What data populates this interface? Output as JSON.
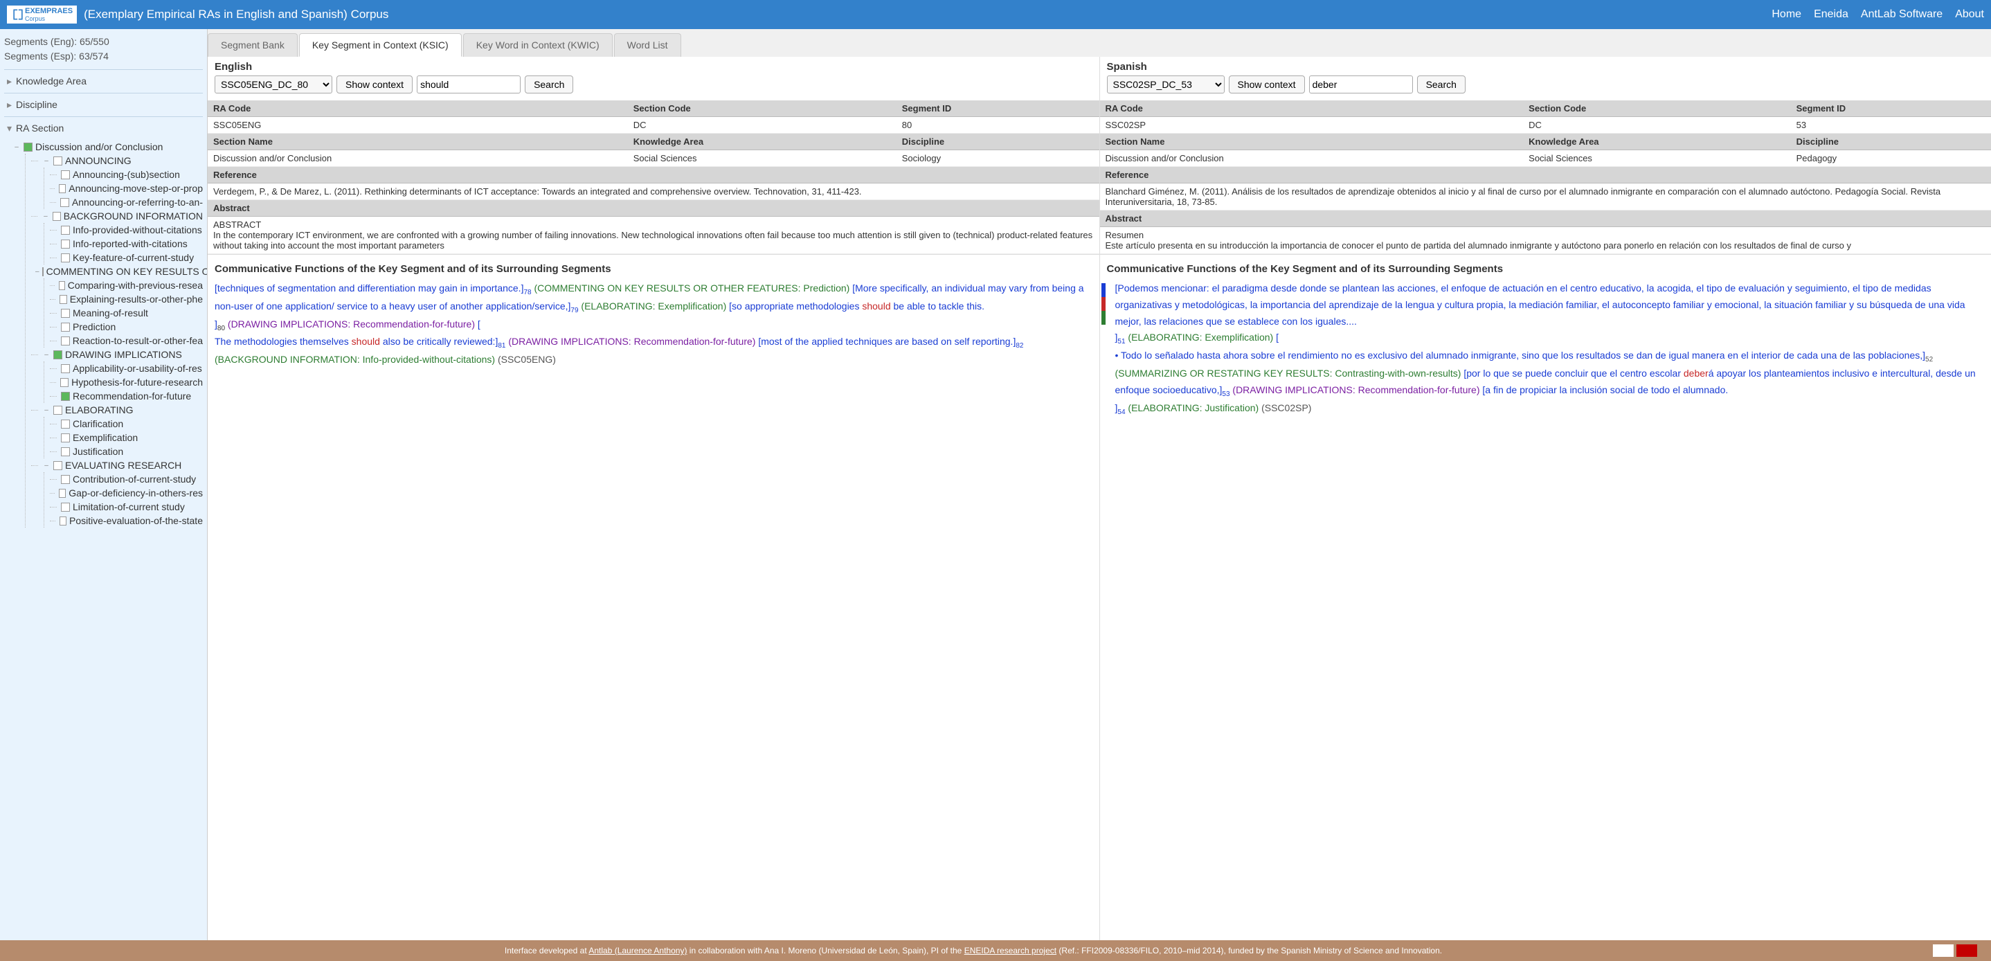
{
  "header": {
    "logo_main": "EXEMPRAES",
    "logo_sub": "Corpus",
    "title": "(Exemplary Empirical RAs in English and Spanish) Corpus",
    "nav": [
      "Home",
      "Eneida",
      "AntLab Software",
      "About"
    ]
  },
  "sidebar": {
    "seg_eng": "Segments (Eng): 65/550",
    "seg_esp": "Segments (Esp): 63/574",
    "sections": [
      "Knowledge Area",
      "Discipline",
      "RA Section"
    ],
    "tree_root": "Discussion and/or Conclusion",
    "groups": [
      {
        "label": "ANNOUNCING",
        "chk": "",
        "children": [
          "Announcing-(sub)section",
          "Announcing-move-step-or-prop",
          "Announcing-or-referring-to-an-"
        ]
      },
      {
        "label": "BACKGROUND INFORMATION",
        "chk": "",
        "children": [
          "Info-provided-without-citations",
          "Info-reported-with-citations",
          "Key-feature-of-current-study"
        ]
      },
      {
        "label": "COMMENTING ON KEY RESULTS O",
        "chk": "",
        "children": [
          "Comparing-with-previous-resea",
          "Explaining-results-or-other-phe",
          "Meaning-of-result",
          "Prediction",
          "Reaction-to-result-or-other-fea"
        ]
      },
      {
        "label": "DRAWING IMPLICATIONS",
        "chk": "partial",
        "children": [
          "Applicability-or-usability-of-res",
          "Hypothesis-for-future-research"
        ],
        "checked_child": "Recommendation-for-future"
      },
      {
        "label": "ELABORATING",
        "chk": "",
        "children": [
          "Clarification",
          "Exemplification",
          "Justification"
        ]
      },
      {
        "label": "EVALUATING RESEARCH",
        "chk": "",
        "children": [
          "Contribution-of-current-study",
          "Gap-or-deficiency-in-others-res",
          "Limitation-of-current study",
          "Positive-evaluation-of-the-state"
        ]
      }
    ]
  },
  "tabs": [
    "Segment Bank",
    "Key Segment in Context (KSIC)",
    "Key Word in Context (KWIC)",
    "Word List"
  ],
  "active_tab": 1,
  "panels": [
    {
      "lang": "English",
      "code_select": "SSC05ENG_DC_80",
      "show_context": "Show context",
      "search_val": "should",
      "search_btn": "Search",
      "meta": {
        "headers1": [
          "RA Code",
          "Section Code",
          "Segment ID"
        ],
        "row1": [
          "SSC05ENG",
          "DC",
          "80"
        ],
        "headers2": [
          "Section Name",
          "Knowledge Area",
          "Discipline"
        ],
        "row2": [
          "Discussion and/or Conclusion",
          "Social Sciences",
          "Sociology"
        ],
        "ref_h": "Reference",
        "ref": "Verdegem, P., & De Marez, L. (2011). Rethinking determinants of ICT acceptance: Towards an integrated and comprehensive overview. Technovation, 31, 411-423.",
        "abs_h": "Abstract",
        "abs": "ABSTRACT\nIn the contemporary ICT environment, we are confronted with a growing number of failing innovations. New technological innovations often fail because too much attention is still given to (technical) product-related features without taking into account the most important parameters"
      },
      "comm_h": "Communicative Functions of the Key Segment and of its Surrounding Segments",
      "comm": {
        "seg1": "[techniques of segmentation and differentiation may gain in importance.]",
        "sub1": "78",
        "lbl1": " (COMMENTING ON KEY RESULTS OR OTHER FEATURES: Prediction) ",
        "seg2": "[More specifically, an individual may vary from being a non-user of one application/ service to a heavy user of another application/service,]",
        "sub2": "79",
        "lbl2": " (ELABORATING: Exemplification) ",
        "seg3a": "[so appropriate methodologies ",
        "seg3_hl": "should",
        "seg3b": " be able to tackle this.</p>]",
        "sub3": "80",
        "lbl3": " (DRAWING IMPLICATIONS: Recommendation-for-future) ",
        "seg4a": "[<p>The methodologies themselves ",
        "seg4_hl": "should",
        "seg4b": " also be critically reviewed:]",
        "sub4": "81",
        "lbl4": " (DRAWING IMPLICATIONS: Recommendation-for-future) ",
        "seg5": "[most of the applied techniques are based on self reporting.]",
        "sub5": "82",
        "lbl5": " (BACKGROUND INFORMATION: Info-provided-without-citations)",
        "code": " (SSC05ENG)"
      }
    },
    {
      "lang": "Spanish",
      "code_select": "SSC02SP_DC_53",
      "show_context": "Show context",
      "search_val": "deber",
      "search_btn": "Search",
      "meta": {
        "headers1": [
          "RA Code",
          "Section Code",
          "Segment ID"
        ],
        "row1": [
          "SSC02SP",
          "DC",
          "53"
        ],
        "headers2": [
          "Section Name",
          "Knowledge Area",
          "Discipline"
        ],
        "row2": [
          "Discussion and/or Conclusion",
          "Social Sciences",
          "Pedagogy"
        ],
        "ref_h": "Reference",
        "ref": "Blanchard Giménez, M. (2011). Análisis de los resultados de aprendizaje obtenidos al inicio y al final de curso por el alumnado inmigrante en comparación con el alumnado autóctono. Pedagogía Social. Revista Interuniversitaria, 18, 73-85.",
        "abs_h": "Abstract",
        "abs": "Resumen\nEste artículo presenta en su introducción la importancia de conocer el punto de partida del alumnado inmigrante y autóctono para ponerlo en relación con los resultados de final de curso y"
      },
      "comm_h": "Communicative Functions of the Key Segment and of its Surrounding Segments",
      "comm": {
        "seg1": "[Podemos mencionar: el paradigma desde donde se plantean las acciones, el enfoque de actuación en el centro educativo, la acogida, el tipo de evaluación y seguimiento, el tipo de medidas organizativas y metodológicas, la importancia del aprendizaje de la lengua y cultura propia, la mediación familiar, el autoconcepto familiar y emocional, la situación familiar y su búsqueda de una vida mejor, las relaciones que se establece con los iguales....</p>]",
        "sub1": "51",
        "lbl1": " (ELABORATING: Exemplification) ",
        "seg2": "[<p>• Todo lo señalado hasta ahora sobre el rendimiento no es exclusivo del alumnado inmigrante, sino que los resultados se dan de igual manera en el interior de cada una de las poblaciones,]",
        "sub2": "52",
        "lbl2": " (SUMMARIZING OR RESTATING KEY RESULTS: Contrasting-with-own-results) ",
        "seg3a": "[por lo que se puede concluir que el centro escolar ",
        "seg3_hl": "deber",
        "seg3b": "á apoyar los planteamientos inclusivo e intercultural, desde un enfoque socioeducativo,]",
        "sub3": "53",
        "lbl3": " (DRAWING IMPLICATIONS: Recommendation-for-future) ",
        "seg4": "[a fin de propiciar la inclusión social de todo el alumnado.</p>]",
        "sub4": "54",
        "lbl4": " (ELABORATING: Justification)",
        "code": " (SSC02SP)"
      }
    }
  ],
  "footer": {
    "t1": "Interface developed at ",
    "l1": "Antlab (Laurence Anthony)",
    "t2": " in collaboration with Ana I. Moreno (Universidad de León, Spain), PI of the ",
    "l2": "ENEIDA research project",
    "t3": " (Ref.: FFI2009-08336/FILO, 2010–mid 2014), funded by the Spanish Ministry of Science and Innovation."
  }
}
